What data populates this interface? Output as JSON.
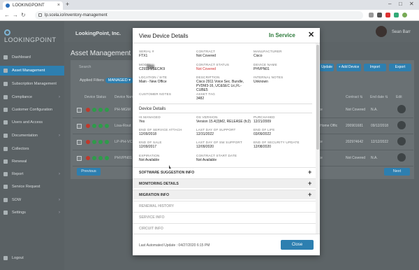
{
  "browser": {
    "tab_title": "LOOKINGPOINT",
    "tab_close": "×",
    "new_tab": "+",
    "url": "lp.scela.io/inventory-management",
    "win_min": "–",
    "win_max": "□",
    "win_close": "✕"
  },
  "app": {
    "logo": "LOOKINGPOINT",
    "company": "LookingPoint, Inc.",
    "user_name": "Sean Barr",
    "page_title": "Asset Management",
    "sidebar": [
      {
        "label": "Dashboard",
        "active": false,
        "chev": ""
      },
      {
        "label": "Asset Management",
        "active": true,
        "chev": ""
      },
      {
        "label": "Subscription Management",
        "active": false,
        "chev": ""
      },
      {
        "label": "Compliance",
        "active": false,
        "chev": "›"
      },
      {
        "label": "Customer Configuration",
        "active": false,
        "chev": ""
      },
      {
        "label": "Users and Access",
        "active": false,
        "chev": ""
      },
      {
        "label": "Documentation",
        "active": false,
        "chev": "›"
      },
      {
        "label": "Collectors",
        "active": false,
        "chev": ""
      },
      {
        "label": "Renewal",
        "active": false,
        "chev": ""
      },
      {
        "label": "Report",
        "active": false,
        "chev": "›"
      },
      {
        "label": "Service Request",
        "active": false,
        "chev": ""
      },
      {
        "label": "SOW",
        "active": false,
        "chev": "›"
      },
      {
        "label": "Settings",
        "active": false,
        "chev": "›"
      },
      {
        "label": "Logout",
        "active": false,
        "chev": ""
      }
    ],
    "search_placeholder": "Search",
    "applied_filters_label": "Applied Filters",
    "filter_chip": "MANAGED ▾",
    "toolbar": {
      "update": "Update",
      "add_device": "+ Add Device",
      "import": "Import",
      "export": "Export"
    },
    "columns": {
      "device_status": "Device Status",
      "device_name": "Device Nam",
      "contract": "Contract ⇅",
      "end_date": "End date ⇅",
      "edit": "Edit"
    },
    "rows": [
      {
        "name": "PH-MGM",
        "location": "fice",
        "contract": "Not Covered",
        "end_date": "N.A."
      },
      {
        "name": "Lisa-Rout",
        "location": "e Home Offic",
        "contract": "200901681",
        "end_date": "09/12/2018"
      },
      {
        "name": "LP-PH-VC",
        "location": "fice",
        "contract": "202974642",
        "end_date": "12/12/2022"
      },
      {
        "name": "PHVPN01",
        "location": "fice",
        "contract": "Not Covered",
        "end_date": "N.A."
      }
    ],
    "pager_prev": "Previous",
    "pager_next": "Next"
  },
  "modal": {
    "title": "View Device Details",
    "status": "In Service",
    "close_x": "✕",
    "fields": [
      {
        "label": "SERIAL #",
        "value": "FTX1",
        "red": false
      },
      {
        "label": "CONTRACT",
        "value": "Not Covered",
        "red": false
      },
      {
        "label": "MANUFACTURER",
        "value": "Cisco",
        "red": false
      },
      {
        "label": "MODEL",
        "value": "C2911-VSEC/K9",
        "red": false
      },
      {
        "label": "CONTRACT STATUS",
        "value": "Not Covered",
        "red": true
      },
      {
        "label": "DEVICE NAME",
        "value": "PHVPN01",
        "red": false
      },
      {
        "label": "LOCATION / SITE",
        "value": "Main - New Office",
        "red": false
      },
      {
        "label": "DESCRIPTION",
        "value": "Cisco 2911 Voice Sec. Bundle, PVDM3-16, UC&SEC Lic,FL-CUBE5",
        "red": false
      },
      {
        "label": "INTERNAL NOTES",
        "value": "Unknown",
        "red": false
      },
      {
        "label": "CUSTOMER NOTES",
        "value": "",
        "red": false
      },
      {
        "label": "ASSET TAG",
        "value": "3482",
        "red": false
      }
    ],
    "device_details_heading": "Device Details",
    "details": [
      {
        "label": "IS MANAGED",
        "value": "Yes"
      },
      {
        "label": "OS VERSION",
        "value": "Version 15.4(3)M2, RELEASE (fc2)"
      },
      {
        "label": "PURCHASED",
        "value": "12/21/2009"
      },
      {
        "label": "END OF SERVICE ATTACH",
        "value": "12/09/2018"
      },
      {
        "label": "LAST DAY OF SUPPORT",
        "value": "12/31/2022"
      },
      {
        "label": "END OF LIFE",
        "value": "03/09/2022"
      },
      {
        "label": "END OF SALE",
        "value": "12/09/2017"
      },
      {
        "label": "LAST DAY OF SW SUPPORT",
        "value": "12/09/2020"
      },
      {
        "label": "END OF SECURITY UPDATE",
        "value": "12/08/2020"
      },
      {
        "label": "EXPIRATION",
        "value": "Not Available"
      },
      {
        "label": "CONTRACT START DATE",
        "value": "Not Available"
      }
    ],
    "sections": [
      {
        "label": "SOFTWARE SUGGESTION INFO",
        "icon": "+",
        "dim": false
      },
      {
        "label": "MONITORING DETAILS",
        "icon": "+",
        "dim": false
      },
      {
        "label": "MIGRATION INFO",
        "icon": "+",
        "dim": false
      },
      {
        "label": "RENEWAL HISTORY",
        "icon": "",
        "dim": true
      },
      {
        "label": "SERVICE INFO",
        "icon": "",
        "dim": true
      },
      {
        "label": "CIRCUIT INFO",
        "icon": "",
        "dim": true
      }
    ],
    "last_update": "Last Automated Update : 04/27/2020 6:15 PM",
    "close_button": "Close"
  },
  "colors": {
    "accent": "#2d7fb0",
    "in_service": "#2c7a3a",
    "red": "#d12c2c"
  },
  "icons": [
    "lock-icon",
    "back-icon",
    "forward-icon",
    "reload-icon",
    "close-icon",
    "plus-icon",
    "logo-icon",
    "avatar"
  ]
}
